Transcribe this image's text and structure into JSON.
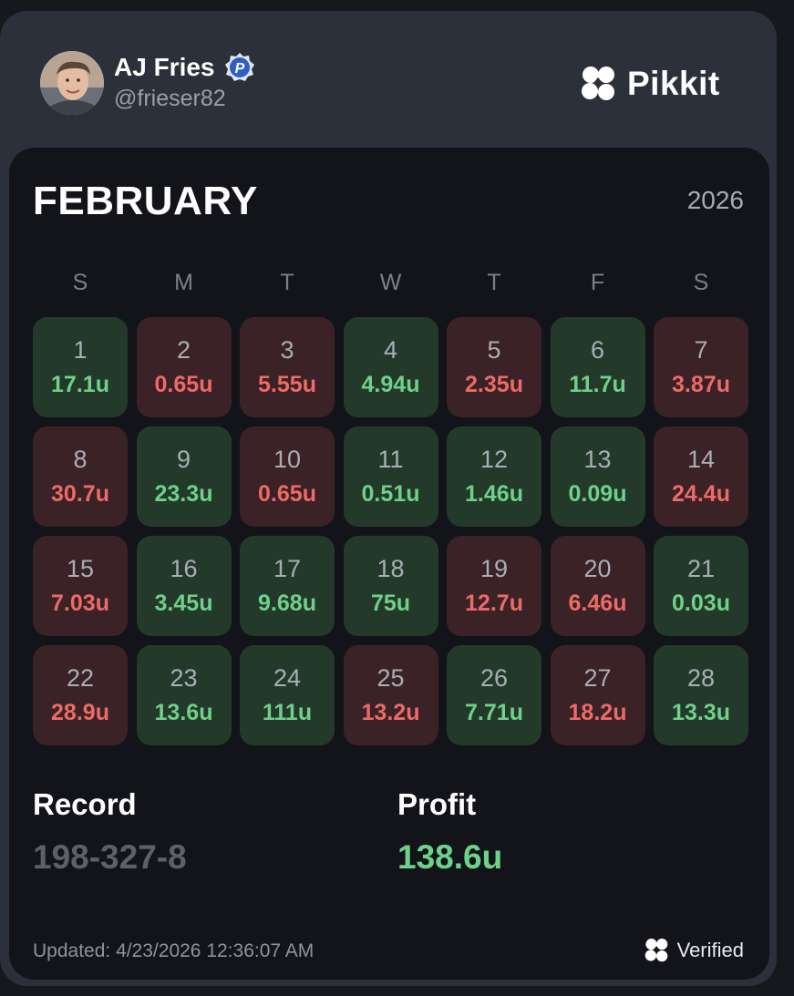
{
  "user": {
    "name": "AJ Fries",
    "handle": "@frieser82",
    "badge_letter": "P"
  },
  "brand": {
    "name": "Pikkit"
  },
  "calendar": {
    "month": "FEBRUARY",
    "year": "2026",
    "weekdays": [
      "S",
      "M",
      "T",
      "W",
      "T",
      "F",
      "S"
    ],
    "days": [
      {
        "day": "1",
        "value": "17.1u",
        "status": "win"
      },
      {
        "day": "2",
        "value": "0.65u",
        "status": "loss"
      },
      {
        "day": "3",
        "value": "5.55u",
        "status": "loss"
      },
      {
        "day": "4",
        "value": "4.94u",
        "status": "win"
      },
      {
        "day": "5",
        "value": "2.35u",
        "status": "loss"
      },
      {
        "day": "6",
        "value": "11.7u",
        "status": "win"
      },
      {
        "day": "7",
        "value": "3.87u",
        "status": "loss"
      },
      {
        "day": "8",
        "value": "30.7u",
        "status": "loss"
      },
      {
        "day": "9",
        "value": "23.3u",
        "status": "win"
      },
      {
        "day": "10",
        "value": "0.65u",
        "status": "loss"
      },
      {
        "day": "11",
        "value": "0.51u",
        "status": "win"
      },
      {
        "day": "12",
        "value": "1.46u",
        "status": "win"
      },
      {
        "day": "13",
        "value": "0.09u",
        "status": "win"
      },
      {
        "day": "14",
        "value": "24.4u",
        "status": "loss"
      },
      {
        "day": "15",
        "value": "7.03u",
        "status": "loss"
      },
      {
        "day": "16",
        "value": "3.45u",
        "status": "win"
      },
      {
        "day": "17",
        "value": "9.68u",
        "status": "win"
      },
      {
        "day": "18",
        "value": "75u",
        "status": "win"
      },
      {
        "day": "19",
        "value": "12.7u",
        "status": "loss"
      },
      {
        "day": "20",
        "value": "6.46u",
        "status": "loss"
      },
      {
        "day": "21",
        "value": "0.03u",
        "status": "win"
      },
      {
        "day": "22",
        "value": "28.9u",
        "status": "loss"
      },
      {
        "day": "23",
        "value": "13.6u",
        "status": "win"
      },
      {
        "day": "24",
        "value": "111u",
        "status": "win"
      },
      {
        "day": "25",
        "value": "13.2u",
        "status": "loss"
      },
      {
        "day": "26",
        "value": "7.71u",
        "status": "win"
      },
      {
        "day": "27",
        "value": "18.2u",
        "status": "loss"
      },
      {
        "day": "28",
        "value": "13.3u",
        "status": "win"
      }
    ]
  },
  "stats": {
    "record_label": "Record",
    "record_value": "198-327-8",
    "profit_label": "Profit",
    "profit_value": "138.6u"
  },
  "footer": {
    "updated": "Updated: 4/23/2026 12:36:07 AM",
    "verified": "Verified"
  },
  "colors": {
    "win_bg": "#233a2b",
    "loss_bg": "#3a2226",
    "win_text": "#6fd189",
    "loss_text": "#ee6a67",
    "badge_blue": "#2f5fc4"
  }
}
